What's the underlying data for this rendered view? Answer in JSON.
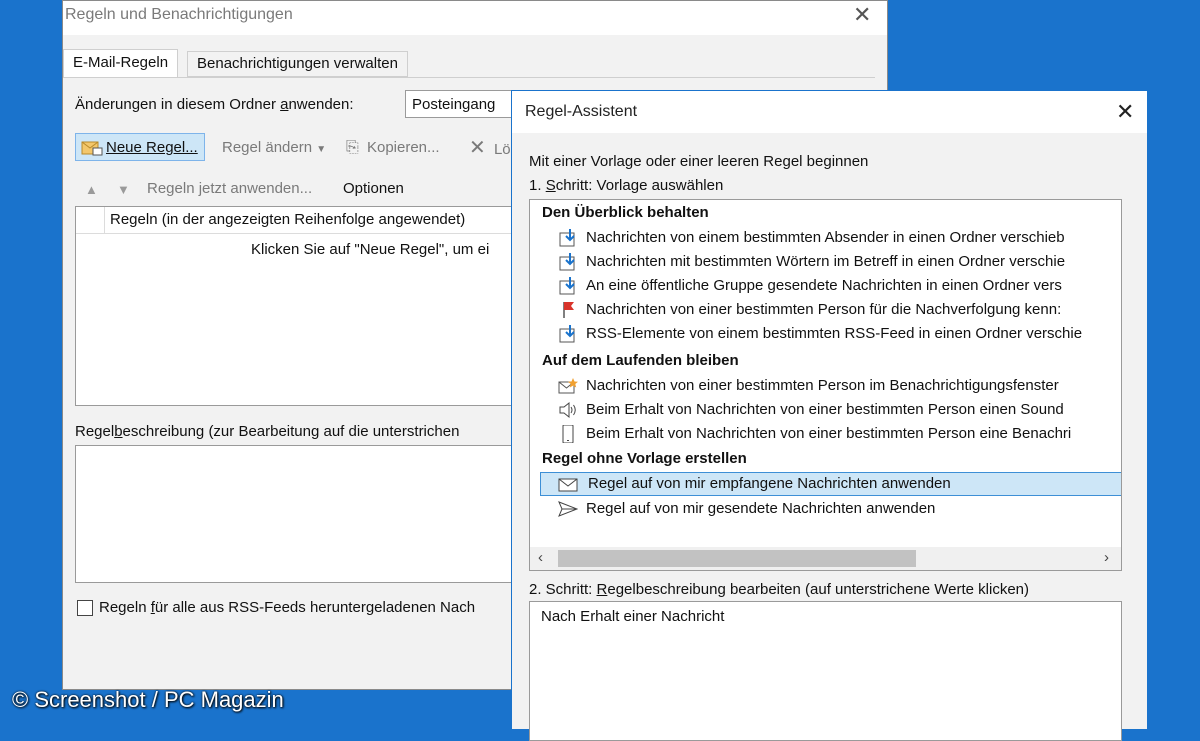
{
  "colors": {
    "background": "#1a73cc",
    "selection": "#cde6f7",
    "selection_border": "#3d8fd6",
    "flag": "#d9342b"
  },
  "rules_window": {
    "title": "Regeln und Benachrichtigungen",
    "tabs": [
      {
        "label": "E-Mail-Regeln",
        "active": true
      },
      {
        "label": "Benachrichtigungen verwalten",
        "active": false
      }
    ],
    "apply_folder_label": "Änderungen in diesem Ordner anwenden:",
    "folder_value": "Posteingang",
    "toolbar": {
      "new_rule": "Neue Regel...",
      "change_rule": "Regel ändern",
      "copy": "Kopieren...",
      "delete": "Lö"
    },
    "apply_now": "Regeln jetzt anwenden...",
    "options": "Optionen",
    "rules_column_header": "Regeln (in der angezeigten Reihenfolge angewendet)",
    "empty_hint": "Klicken Sie auf \"Neue Regel\", um ei",
    "description_label": "Regelbeschreibung (zur Bearbeitung auf die unterstrichen",
    "rss_checkbox_label": "Regeln für alle aus RSS-Feeds heruntergeladenen Nach",
    "rss_checked": false
  },
  "wizard": {
    "title": "Regel-Assistent",
    "intro": "Mit einer Vorlage oder einer leeren Regel beginnen",
    "step1": "1. Schritt: Vorlage auswählen",
    "groups": [
      {
        "header": "Den Überblick behalten",
        "items": [
          {
            "label": "Nachrichten von einem bestimmten Absender in einen Ordner verschieb",
            "icon": "move-to-folder-icon"
          },
          {
            "label": "Nachrichten mit bestimmten Wörtern im Betreff in einen Ordner verschie",
            "icon": "move-to-folder-icon"
          },
          {
            "label": "An eine öffentliche Gruppe gesendete Nachrichten in einen Ordner vers",
            "icon": "move-to-folder-icon"
          },
          {
            "label": "Nachrichten von einer bestimmten Person für die Nachverfolgung kenn:",
            "icon": "flag-icon"
          },
          {
            "label": "RSS-Elemente von einem bestimmten RSS-Feed in einen Ordner verschie",
            "icon": "move-to-folder-icon"
          }
        ]
      },
      {
        "header": "Auf dem Laufenden bleiben",
        "items": [
          {
            "label": "Nachrichten von einer bestimmten Person im Benachrichtigungsfenster",
            "icon": "envelope-star-icon"
          },
          {
            "label": "Beim Erhalt von Nachrichten von einer bestimmten Person einen Sound",
            "icon": "speaker-icon"
          },
          {
            "label": "Beim Erhalt von Nachrichten von einer bestimmten Person eine Benachri",
            "icon": "mobile-phone-icon"
          }
        ]
      },
      {
        "header": "Regel ohne Vorlage erstellen",
        "items": [
          {
            "label": "Regel auf von mir empfangene Nachrichten anwenden",
            "icon": "envelope-icon",
            "selected": true
          },
          {
            "label": "Regel auf von mir gesendete Nachrichten anwenden",
            "icon": "send-icon"
          }
        ]
      }
    ],
    "step2": "2. Schritt: Regelbeschreibung bearbeiten (auf unterstrichene Werte klicken)",
    "description_text": "Nach Erhalt einer Nachricht"
  },
  "watermark": "© Screenshot / PC Magazin"
}
